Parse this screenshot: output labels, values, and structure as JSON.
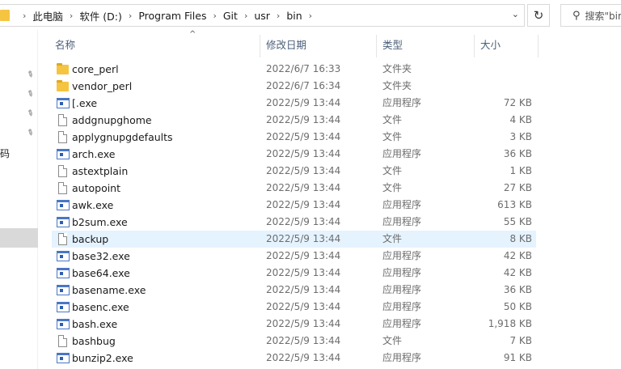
{
  "address": {
    "breadcrumbs": [
      "此电脑",
      "软件 (D:)",
      "Program Files",
      "Git",
      "usr",
      "bin"
    ]
  },
  "search": {
    "placeholder": "搜索\"bin\""
  },
  "nav": {
    "partial_label": "码"
  },
  "columns": {
    "name": "名称",
    "date": "修改日期",
    "type": "类型",
    "size": "大小"
  },
  "files": [
    {
      "name": "core_perl",
      "date": "2022/6/7 16:33",
      "type": "文件夹",
      "size": "",
      "icon": "folder-icon"
    },
    {
      "name": "vendor_perl",
      "date": "2022/6/7 16:34",
      "type": "文件夹",
      "size": "",
      "icon": "folder-icon"
    },
    {
      "name": "[.exe",
      "date": "2022/5/9 13:44",
      "type": "应用程序",
      "size": "72 KB",
      "icon": "exe-icon"
    },
    {
      "name": "addgnupghome",
      "date": "2022/5/9 13:44",
      "type": "文件",
      "size": "4 KB",
      "icon": "file-icon"
    },
    {
      "name": "applygnupgdefaults",
      "date": "2022/5/9 13:44",
      "type": "文件",
      "size": "3 KB",
      "icon": "file-icon"
    },
    {
      "name": "arch.exe",
      "date": "2022/5/9 13:44",
      "type": "应用程序",
      "size": "36 KB",
      "icon": "exe-icon"
    },
    {
      "name": "astextplain",
      "date": "2022/5/9 13:44",
      "type": "文件",
      "size": "1 KB",
      "icon": "file-icon"
    },
    {
      "name": "autopoint",
      "date": "2022/5/9 13:44",
      "type": "文件",
      "size": "27 KB",
      "icon": "file-icon"
    },
    {
      "name": "awk.exe",
      "date": "2022/5/9 13:44",
      "type": "应用程序",
      "size": "613 KB",
      "icon": "exe-icon"
    },
    {
      "name": "b2sum.exe",
      "date": "2022/5/9 13:44",
      "type": "应用程序",
      "size": "55 KB",
      "icon": "exe-icon"
    },
    {
      "name": "backup",
      "date": "2022/5/9 13:44",
      "type": "文件",
      "size": "8 KB",
      "icon": "file-icon",
      "hover": true
    },
    {
      "name": "base32.exe",
      "date": "2022/5/9 13:44",
      "type": "应用程序",
      "size": "42 KB",
      "icon": "exe-icon"
    },
    {
      "name": "base64.exe",
      "date": "2022/5/9 13:44",
      "type": "应用程序",
      "size": "42 KB",
      "icon": "exe-icon"
    },
    {
      "name": "basename.exe",
      "date": "2022/5/9 13:44",
      "type": "应用程序",
      "size": "36 KB",
      "icon": "exe-icon"
    },
    {
      "name": "basenc.exe",
      "date": "2022/5/9 13:44",
      "type": "应用程序",
      "size": "50 KB",
      "icon": "exe-icon"
    },
    {
      "name": "bash.exe",
      "date": "2022/5/9 13:44",
      "type": "应用程序",
      "size": "1,918 KB",
      "icon": "exe-icon"
    },
    {
      "name": "bashbug",
      "date": "2022/5/9 13:44",
      "type": "文件",
      "size": "7 KB",
      "icon": "file-icon"
    },
    {
      "name": "bunzip2.exe",
      "date": "2022/5/9 13:44",
      "type": "应用程序",
      "size": "91 KB",
      "icon": "exe-icon"
    }
  ]
}
